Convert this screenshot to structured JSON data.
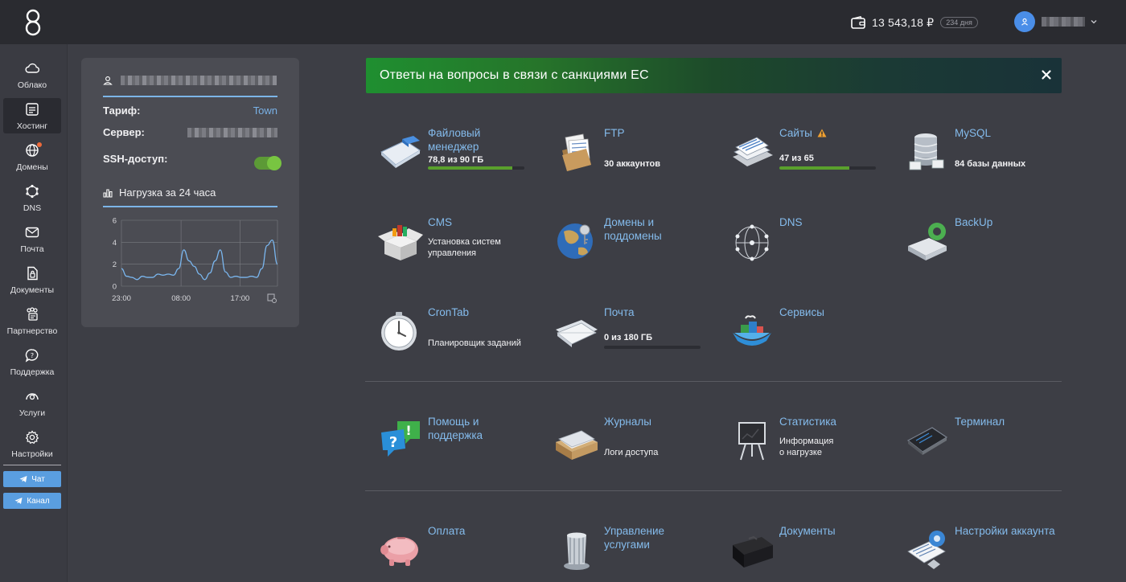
{
  "topbar": {
    "balance": "13 543,18 ₽",
    "days_left": "234 дня"
  },
  "sidebar": {
    "items": [
      {
        "label": "Облако",
        "icon": "cloud-icon"
      },
      {
        "label": "Хостинг",
        "icon": "hosting-icon",
        "active": true
      },
      {
        "label": "Домены",
        "icon": "globe-icon",
        "badge": true
      },
      {
        "label": "DNS",
        "icon": "dns-icon"
      },
      {
        "label": "Почта",
        "icon": "mail-icon"
      },
      {
        "label": "Документы",
        "icon": "documents-icon"
      },
      {
        "label": "Партнерство",
        "icon": "partnership-icon"
      },
      {
        "label": "Поддержка",
        "icon": "support-icon"
      },
      {
        "label": "Услуги",
        "icon": "services-icon"
      },
      {
        "label": "Настройки",
        "icon": "gear-icon"
      }
    ],
    "chat_label": "Чат",
    "channel_label": "Канал"
  },
  "panel": {
    "tariff_label": "Тариф:",
    "tariff_value": "Town",
    "server_label": "Сервер:",
    "ssh_label": "SSH-доступ:",
    "ssh_enabled": true,
    "load_title": "Нагрузка за 24 часа"
  },
  "chart_data": {
    "type": "line",
    "title": "Нагрузка за 24 часа",
    "x_ticks": [
      "23:00",
      "08:00",
      "17:00"
    ],
    "y_ticks": [
      0,
      2,
      4,
      6
    ],
    "ylim": [
      0,
      6
    ],
    "grid": true,
    "series": [
      {
        "values": [
          1.6,
          0.9,
          0.8,
          0.6,
          0.9,
          0.8,
          0.8,
          1.1,
          1.0,
          1.1,
          1.0,
          1.6,
          3.3,
          2.3,
          1.8,
          1.1,
          0.6,
          1.2,
          2.3,
          3.3,
          1.3,
          0.8,
          0.9,
          0.8,
          0.8,
          0.9,
          0.8,
          1.6,
          3.7,
          4.2,
          2.0
        ]
      }
    ]
  },
  "banner": {
    "text": "Ответы на вопросы в связи с санкциями ЕС"
  },
  "tiles": {
    "file_manager": {
      "title1": "Файловый",
      "title2": "менеджер",
      "sub": "78,8 из 90 ГБ",
      "progress": 0.876
    },
    "ftp": {
      "title": "FTP",
      "sub": "30 аккаунтов"
    },
    "sites": {
      "title": "Сайты",
      "sub": "47 из 65",
      "progress": 0.723
    },
    "mysql": {
      "title": "MySQL",
      "sub": "84 базы данных"
    },
    "cms": {
      "title": "CMS",
      "sub1": "Установка систем",
      "sub2": "управления"
    },
    "domains": {
      "title1": "Домены и",
      "title2": "поддомены"
    },
    "dns": {
      "title": "DNS"
    },
    "backup": {
      "title": "BackUp"
    },
    "crontab": {
      "title": "CronTab",
      "sub": "Планировщик заданий"
    },
    "mail": {
      "title": "Почта",
      "sub": "0 из 180 ГБ",
      "progress": 0.0
    },
    "services": {
      "title": "Сервисы"
    },
    "help": {
      "title1": "Помощь и",
      "title2": "поддержка"
    },
    "logs": {
      "title": "Журналы",
      "sub": "Логи доступа"
    },
    "stats": {
      "title": "Статистика",
      "sub1": "Информация",
      "sub2": "о нагрузке"
    },
    "terminal": {
      "title": "Терминал"
    },
    "payment": {
      "title": "Оплата"
    },
    "services_mgmt": {
      "title1": "Управление",
      "title2": "услугами"
    },
    "documents": {
      "title": "Документы"
    },
    "account_settings": {
      "title": "Настройки аккаунта"
    }
  }
}
